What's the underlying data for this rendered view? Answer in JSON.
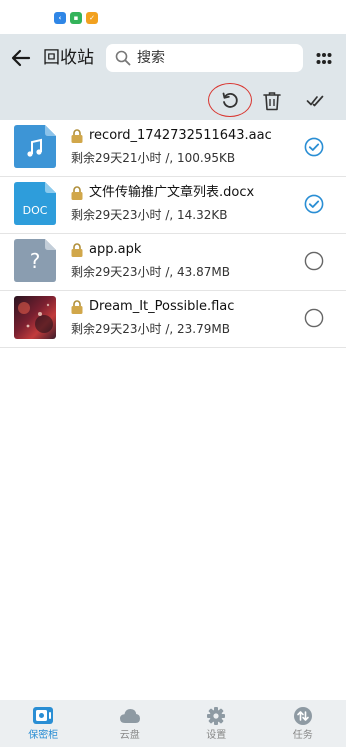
{
  "header": {
    "title": "回收站",
    "search_placeholder": "搜索"
  },
  "files": [
    {
      "name": "record_1742732511643.aac",
      "meta": "剩余29天21小时 /, 100.95KB",
      "type": "audio",
      "selected": true
    },
    {
      "name": "文件传输推广文章列表.docx",
      "meta": "剩余29天23小时 /, 14.32KB",
      "type": "doc",
      "thumb_label": "DOC",
      "selected": true
    },
    {
      "name": "app.apk",
      "meta": "剩余29天23小时 /, 43.87MB",
      "type": "unknown",
      "thumb_label": "?",
      "selected": false
    },
    {
      "name": "Dream_It_Possible.flac",
      "meta": "剩余29天23小时 /, 23.79MB",
      "type": "image-cover",
      "selected": false
    }
  ],
  "bottom_nav": [
    {
      "label": "保密柜",
      "icon": "safe-icon",
      "active": true
    },
    {
      "label": "云盘",
      "icon": "cloud-icon",
      "active": false
    },
    {
      "label": "设置",
      "icon": "gear-icon",
      "active": false
    },
    {
      "label": "任务",
      "icon": "transfer-icon",
      "active": false
    }
  ],
  "colors": {
    "accent": "#2a8ed4",
    "header_bg": "#dfe6ea",
    "highlight_ring": "#d9352f"
  }
}
